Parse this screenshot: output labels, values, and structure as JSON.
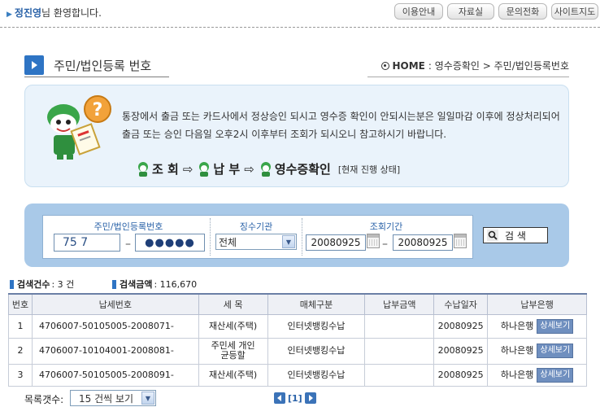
{
  "header": {
    "user_name": "정진영",
    "welcome_suffix": "님 환영합니다.",
    "links": [
      "이용안내",
      "자료실",
      "문의전화",
      "사이트지도"
    ]
  },
  "page": {
    "title": "주민/법인등록 번호",
    "breadcrumb": {
      "home": "HOME",
      "path": ": 영수증확인 > 주민/법인등록번호"
    }
  },
  "notice": {
    "text": "통장에서 출금 또는 카드사에서 정상승인 되시고 영수증 확인이 안되시는분은 일일마감 이후에 정상처리되어 출금 또는 승인 다음일 오후2시 이후부터 조회가 되시오니 참고하시기 바랍니다.",
    "steps": [
      "조 회",
      "납 부",
      "영수증확인"
    ],
    "status_note": "[현재 진행 상태]"
  },
  "search": {
    "id_label": "주민/법인등록번호",
    "id_part1": "75    7",
    "id_part2": "●●●●●",
    "agency_label": "징수기관",
    "agency_selected": "전체",
    "period_label": "조회기간",
    "date_from": "20080925",
    "date_to": "20080925",
    "button_label": "검  색"
  },
  "summary": {
    "count_label": "검색건수",
    "count_value": ": 3 건",
    "amount_label": "검색금액",
    "amount_value": ": 116,670"
  },
  "table": {
    "headers": [
      "번호",
      "납세번호",
      "세  목",
      "매체구분",
      "납부금액",
      "수납일자",
      "납부은행"
    ],
    "rows": [
      {
        "no": "1",
        "tax_no": "4706007-50105005-2008071-",
        "item": "재산세(주택)",
        "media": "인터넷뱅킹수납",
        "amount": "",
        "date": "20080925",
        "bank": "하나은행",
        "detail": "상세보기"
      },
      {
        "no": "2",
        "tax_no": "4706007-10104001-2008081-",
        "item": "주민세 개인균등할",
        "media": "인터넷뱅킹수납",
        "amount": "",
        "date": "20080925",
        "bank": "하나은행",
        "detail": "상세보기"
      },
      {
        "no": "3",
        "tax_no": "4706007-50105005-2008091-",
        "item": "재산세(주택)",
        "media": "인터넷뱅킹수납",
        "amount": "",
        "date": "20080925",
        "bank": "하나은행",
        "detail": "상세보기"
      }
    ]
  },
  "footer": {
    "page_size_label": "목록갯수:",
    "page_size_selected": "15 건씩 보기",
    "current_page": "[1]"
  }
}
